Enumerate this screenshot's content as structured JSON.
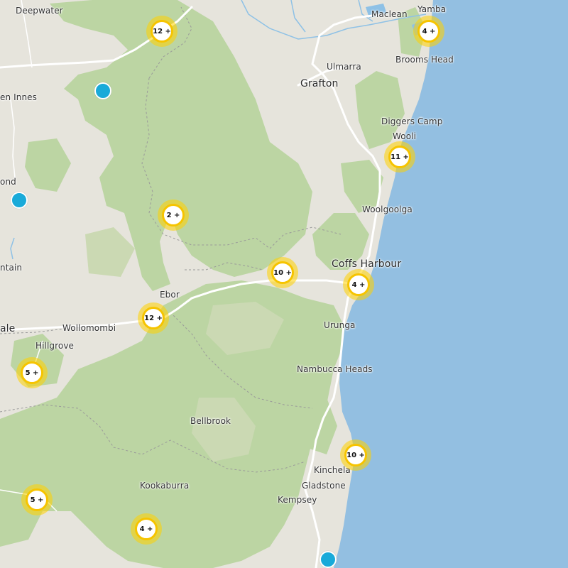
{
  "map": {
    "colors": {
      "land": "#e6e4dc",
      "forest": "#bcd5a3",
      "sea": "#93bfe1",
      "road": "#ffffff",
      "boundary": "#9a9a9a",
      "river": "#8ec1e6",
      "cluster_ring": "#f6c400",
      "marker": "#19aad9"
    },
    "places": [
      {
        "id": "deepwater",
        "name": "Deepwater"
      },
      {
        "id": "maclean",
        "name": "Maclean"
      },
      {
        "id": "yamba",
        "name": "Yamba"
      },
      {
        "id": "brooms-head",
        "name": "Brooms Head"
      },
      {
        "id": "ulmarra",
        "name": "Ulmarra"
      },
      {
        "id": "grafton",
        "name": "Grafton"
      },
      {
        "id": "glen-innes",
        "name": "en Innes"
      },
      {
        "id": "diggers-camp",
        "name": "Diggers Camp"
      },
      {
        "id": "wooli",
        "name": "Wooli"
      },
      {
        "id": "guyra",
        "name": "ond"
      },
      {
        "id": "woolgoolga",
        "name": "Woolgoolga"
      },
      {
        "id": "coffs-harbour",
        "name": "Coffs Harbour"
      },
      {
        "id": "fountain",
        "name": "ntain"
      },
      {
        "id": "ebor",
        "name": "Ebor"
      },
      {
        "id": "urunga",
        "name": "Urunga"
      },
      {
        "id": "armidale",
        "name": "ale"
      },
      {
        "id": "wollomombi",
        "name": "Wollomombi"
      },
      {
        "id": "hillgrove",
        "name": "Hillgrove"
      },
      {
        "id": "nambucca-heads",
        "name": "Nambucca Heads"
      },
      {
        "id": "bellbrook",
        "name": "Bellbrook"
      },
      {
        "id": "kinchela",
        "name": "Kinchela"
      },
      {
        "id": "gladstone",
        "name": "Gladstone"
      },
      {
        "id": "kookaburra",
        "name": "Kookaburra"
      },
      {
        "id": "kempsey",
        "name": "Kempsey"
      }
    ],
    "clusters": [
      {
        "id": "c1",
        "label": "12 +"
      },
      {
        "id": "c2",
        "label": "4 +"
      },
      {
        "id": "c3",
        "label": "11 +"
      },
      {
        "id": "c4",
        "label": "2 +"
      },
      {
        "id": "c5",
        "label": "10 +"
      },
      {
        "id": "c6",
        "label": "4 +"
      },
      {
        "id": "c7",
        "label": "12 +"
      },
      {
        "id": "c8",
        "label": "5 +"
      },
      {
        "id": "c9",
        "label": "10 +"
      },
      {
        "id": "c10",
        "label": "5 +"
      },
      {
        "id": "c11",
        "label": "4 +"
      }
    ],
    "markers": [
      {
        "id": "m1"
      },
      {
        "id": "m2"
      },
      {
        "id": "m3"
      }
    ]
  }
}
